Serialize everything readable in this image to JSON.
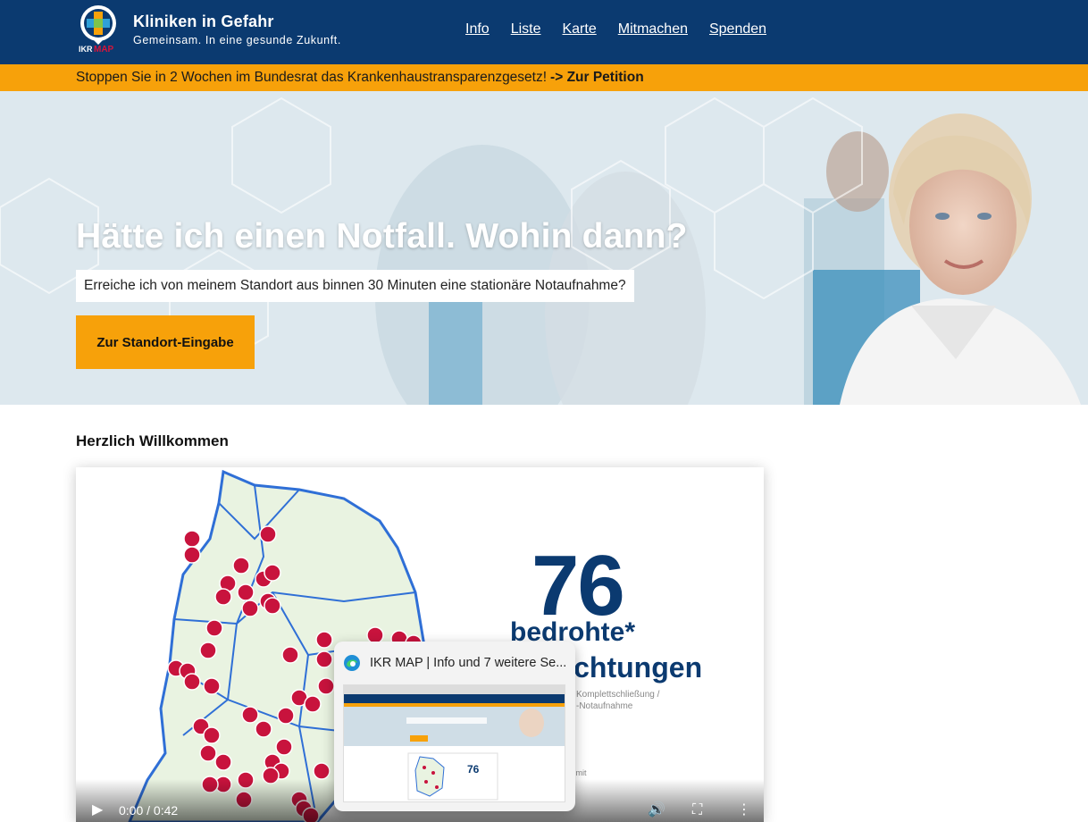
{
  "header": {
    "logo_text": "IKR MAP",
    "title": "Kliniken in Gefahr",
    "subtitle": "Gemeinsam. In eine gesunde Zukunft.",
    "nav": [
      "Info",
      "Liste",
      "Karte",
      "Mitmachen",
      "Spenden"
    ]
  },
  "banner": {
    "text": "Stoppen Sie in 2 Wochen im Bundesrat das Krankenhaustransparenzgesetz!",
    "link": "-> Zur Petition"
  },
  "hero": {
    "headline": "Hätte ich einen Notfall. Wohin dann?",
    "subline": "Erreiche ich von meinem Standort aus binnen 30 Minuten eine stationäre Notaufnahme?",
    "button": "Zur Standort-Eingabe"
  },
  "welcome": "Herzlich Willkommen",
  "video": {
    "big_number": "76",
    "line1": "bedrohte*",
    "line2": "Einrichtungen",
    "note1": "Komplettschließung /",
    "note2": "-Notaufnahme",
    "note3": "ss mit",
    "time": "0:00 / 0:42"
  },
  "tab_preview": {
    "title": "IKR MAP | Info und 7 weitere Se..."
  },
  "colors": {
    "navy": "#0b3a70",
    "orange": "#f7a10a",
    "map_blue": "#2f6fd6",
    "pin_red": "#c8133d"
  }
}
